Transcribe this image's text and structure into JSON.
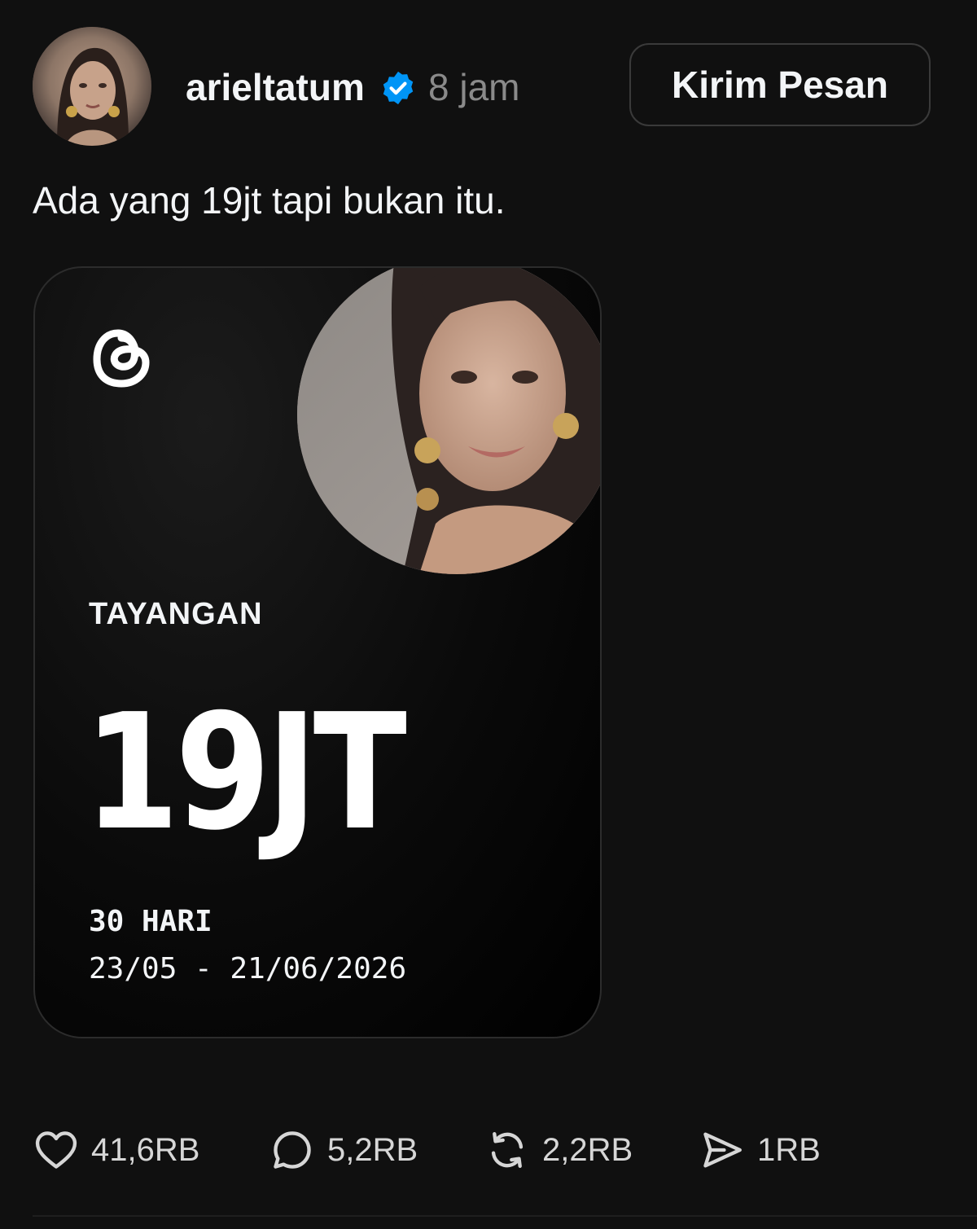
{
  "post": {
    "author": {
      "username": "arieltatum",
      "verified": true,
      "verified_icon": "verified-badge-icon",
      "time": "8 jam"
    },
    "message_button_label": "Kirim Pesan",
    "caption": "Ada yang 19jt tapi bukan itu.",
    "card": {
      "logo_icon": "threads-logo-icon",
      "metric_label": "TAYANGAN",
      "metric_value": "19JT",
      "period": "30 HARI",
      "date_range": "23/05 - 21/06/2026"
    },
    "actions": {
      "likes": "41,6RB",
      "replies": "5,2RB",
      "reposts": "2,2RB",
      "shares": "1RB"
    }
  },
  "colors": {
    "background": "#101010",
    "text": "#f3f5f7",
    "muted": "#8a8a8a",
    "verified_blue": "#0095f6"
  }
}
